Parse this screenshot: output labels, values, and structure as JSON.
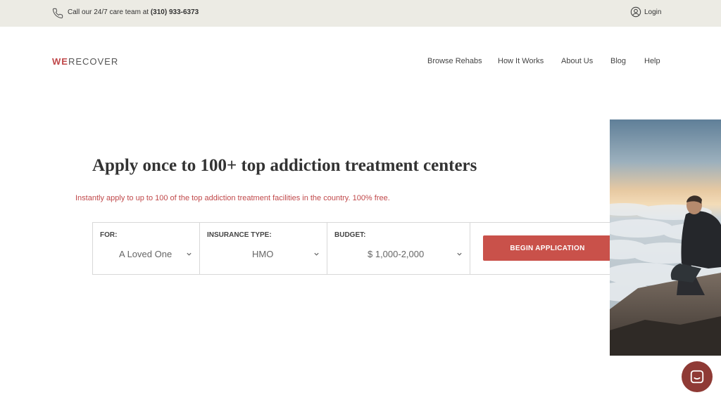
{
  "topbar": {
    "call_prefix": "Call our 24/7 care team at ",
    "phone_number": "(310) 933-6373",
    "login_label": "Login"
  },
  "logo": {
    "part1": "WE",
    "part2": "RECOVER"
  },
  "nav": {
    "items": [
      {
        "label": "Browse Rehabs"
      },
      {
        "label": "How It Works"
      },
      {
        "label": "About Us"
      },
      {
        "label": "Blog"
      },
      {
        "label": "Help"
      }
    ]
  },
  "hero": {
    "title": "Apply once to 100+ top addiction treatment centers",
    "subtitle": "Instantly apply to up to 100 of the top addiction treatment facilities in the country. 100% free."
  },
  "form": {
    "for": {
      "label": "FOR:",
      "value": "A Loved One"
    },
    "insurance": {
      "label": "INSURANCE TYPE:",
      "value": "HMO"
    },
    "budget": {
      "label": "BUDGET:",
      "value": "$ 1,000-2,000"
    },
    "submit_label": "BEGIN APPLICATION"
  },
  "colors": {
    "brand_red": "#c0484a",
    "button": "#c9514a",
    "topbar_bg": "#ecebe4",
    "chat_bubble": "#8f3a35"
  },
  "icons": {
    "phone": "phone-icon",
    "login": "user-circle-icon",
    "dropdown": "chevron-down-icon",
    "chat": "chat-icon"
  }
}
